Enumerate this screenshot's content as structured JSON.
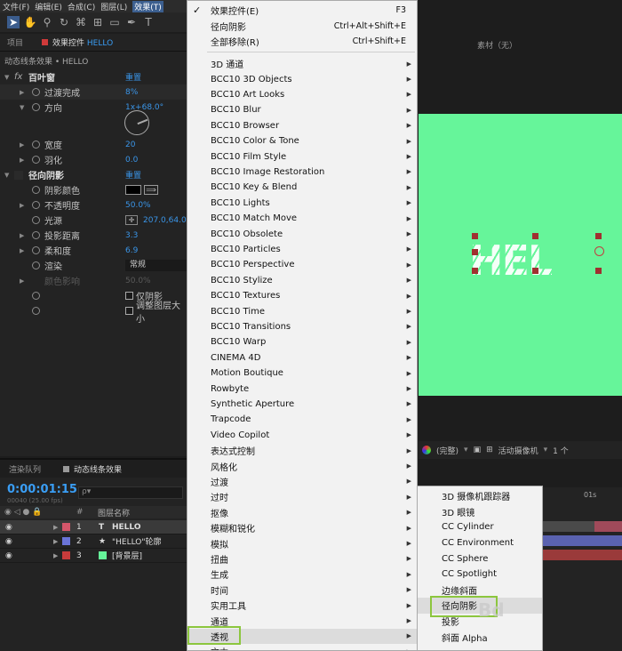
{
  "menubar": {
    "items": [
      "文件(F)",
      "编辑(E)",
      "合成(C)",
      "图层(L)",
      "效果(T)"
    ],
    "active_index": 4
  },
  "panel_tabs": {
    "project": "项目",
    "effect_controls_prefix": "效果控件",
    "effect_controls_layer": "HELLO"
  },
  "effect_controls": {
    "breadcrumb": "动态线条效果 • HELLO",
    "fx_label": "fx",
    "venetian": {
      "name": "百叶窗",
      "reset": "重置",
      "transition_label": "过渡完成",
      "transition_value": "8%",
      "direction_label": "方向",
      "direction_value": "1x+68.0°",
      "width_label": "宽度",
      "width_value": "20",
      "feather_label": "羽化",
      "feather_value": "0.0"
    },
    "radial_shadow": {
      "name": "径向阴影",
      "reset": "重置",
      "shadow_color_label": "阴影颜色",
      "opacity_label": "不透明度",
      "opacity_value": "50.0%",
      "light_source_label": "光源",
      "light_source_value": "207.0,64.0",
      "projection_distance_label": "投影距离",
      "projection_distance_value": "3.3",
      "softness_label": "柔和度",
      "softness_value": "6.9",
      "render_label": "渲染",
      "render_value": "常规",
      "color_influence_label": "颜色影响",
      "color_influence_value": "50.0%",
      "shadow_only_label": "仅阴影",
      "resize_layer_label": "调整图层大小"
    }
  },
  "timeline": {
    "tabs": [
      "渲染队列",
      "动态线条效果"
    ],
    "timecode": "0:00:01:15",
    "fps": "00040 (25.00 fps)",
    "search_placeholder": "ρ▾",
    "layer_name_header": "图层名称",
    "num_header": "#",
    "layers": [
      {
        "num": "1",
        "icon": "T",
        "name": "HELLO",
        "color": "#d4566a"
      },
      {
        "num": "2",
        "icon": "★",
        "name": "\"HELLO\"轮廓",
        "color": "#6a74d8"
      },
      {
        "num": "3",
        "icon": "",
        "name": "[背景层]",
        "color": "#c73b3b"
      }
    ],
    "ruler_label": "01s"
  },
  "composition": {
    "tab_label": "素材（无）",
    "canvas_color": "#66f59a",
    "text": "HEL",
    "view_label": "(完整)",
    "camera_label": "活动摄像机",
    "view_count": "1 个"
  },
  "effect_menu": {
    "top_items": [
      {
        "label": "效果控件(E)",
        "shortcut": "F3",
        "checked": true
      },
      {
        "label": "径向阴影",
        "shortcut": "Ctrl+Alt+Shift+E"
      },
      {
        "label": "全部移除(R)",
        "shortcut": "Ctrl+Shift+E"
      }
    ],
    "categories": [
      "3D 通道",
      "BCC10 3D Objects",
      "BCC10 Art Looks",
      "BCC10 Blur",
      "BCC10 Browser",
      "BCC10 Color & Tone",
      "BCC10 Film Style",
      "BCC10 Image Restoration",
      "BCC10 Key & Blend",
      "BCC10 Lights",
      "BCC10 Match Move",
      "BCC10 Obsolete",
      "BCC10 Particles",
      "BCC10 Perspective",
      "BCC10 Stylize",
      "BCC10 Textures",
      "BCC10 Time",
      "BCC10 Transitions",
      "BCC10 Warp",
      "CINEMA 4D",
      "Motion Boutique",
      "Rowbyte",
      "Synthetic Aperture",
      "Trapcode",
      "Video Copilot",
      "表达式控制",
      "风格化",
      "过渡",
      "过时",
      "抠像",
      "模糊和锐化",
      "模拟",
      "扭曲",
      "生成",
      "时间",
      "实用工具",
      "通道",
      "透视",
      "文本"
    ],
    "highlighted": "透视"
  },
  "perspective_submenu": {
    "items": [
      "3D 摄像机跟踪器",
      "3D 眼镜",
      "CC Cylinder",
      "CC Environment",
      "CC Sphere",
      "CC Spotlight",
      "边缘斜面",
      "径向阴影",
      "投影",
      "斜面 Alpha"
    ],
    "highlighted": "径向阴影",
    "watermark": "Bd"
  }
}
